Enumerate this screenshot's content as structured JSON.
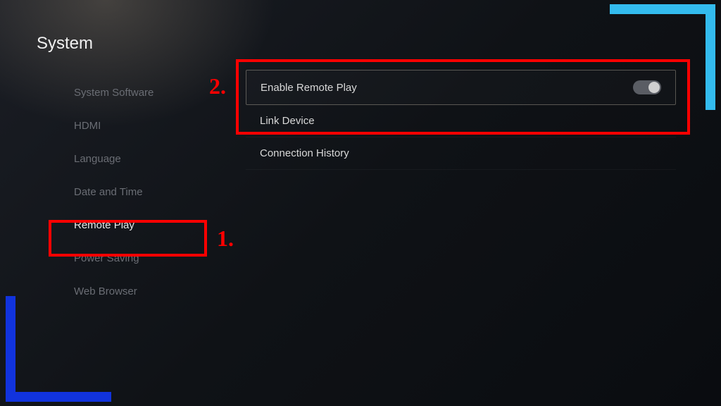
{
  "page_title": "System",
  "sidebar": {
    "items": [
      {
        "label": "System Software",
        "active": false
      },
      {
        "label": "HDMI",
        "active": false
      },
      {
        "label": "Language",
        "active": false
      },
      {
        "label": "Date and Time",
        "active": false
      },
      {
        "label": "Remote Play",
        "active": true
      },
      {
        "label": "Power Saving",
        "active": false
      },
      {
        "label": "Web Browser",
        "active": false
      }
    ]
  },
  "main": {
    "rows": [
      {
        "label": "Enable Remote Play",
        "has_toggle": true,
        "highlighted": true
      },
      {
        "label": "Link Device",
        "has_toggle": false,
        "highlighted": false
      },
      {
        "label": "Connection History",
        "has_toggle": false,
        "highlighted": false
      }
    ]
  },
  "annotations": {
    "label_1": "1.",
    "label_2": "2."
  }
}
